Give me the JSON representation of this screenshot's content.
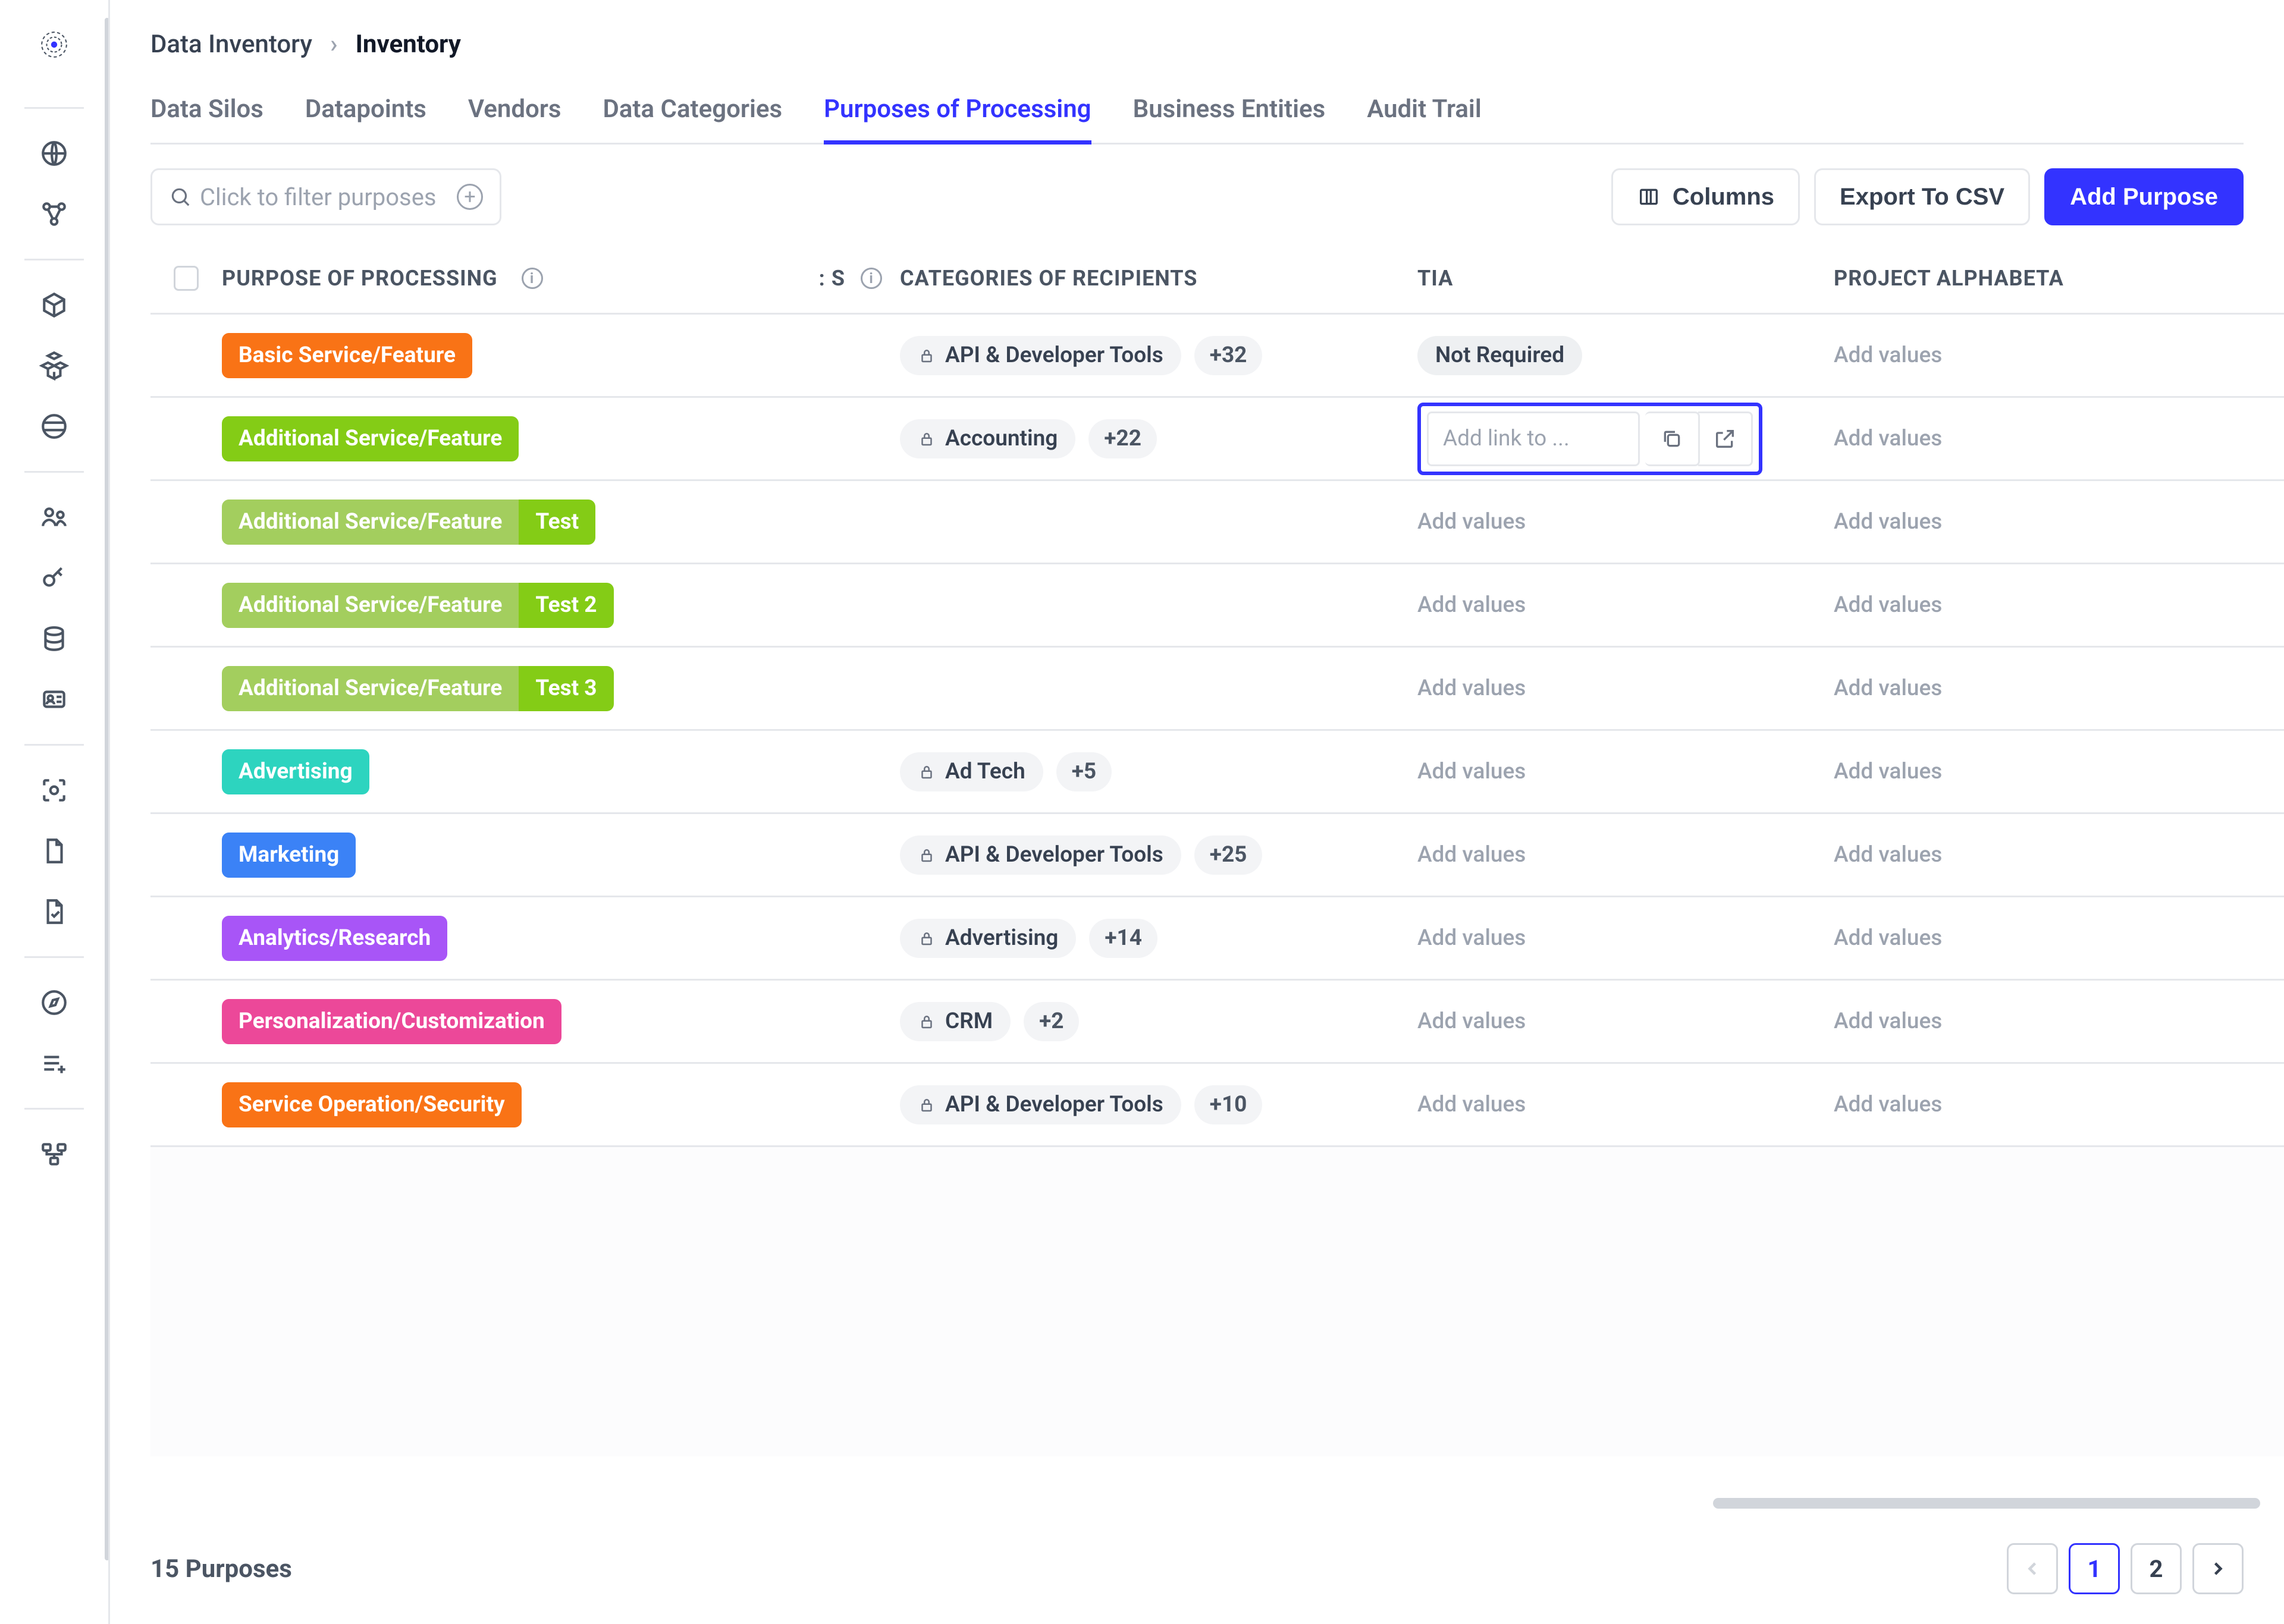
{
  "breadcrumbs": {
    "root": "Data Inventory",
    "current": "Inventory"
  },
  "tabs": [
    {
      "label": "Data Silos",
      "active": false
    },
    {
      "label": "Datapoints",
      "active": false
    },
    {
      "label": "Vendors",
      "active": false
    },
    {
      "label": "Data Categories",
      "active": false
    },
    {
      "label": "Purposes of Processing",
      "active": true
    },
    {
      "label": "Business Entities",
      "active": false
    },
    {
      "label": "Audit Trail",
      "active": false
    }
  ],
  "toolbar": {
    "filter_placeholder": "Click to filter purposes",
    "columns_label": "Columns",
    "export_label": "Export To CSV",
    "add_label": "Add Purpose"
  },
  "columns": {
    "purpose": "PURPOSE OF PROCESSING",
    "truncated_suffix": "S",
    "categories": "CATEGORIES OF RECIPIENTS",
    "tia": "TIA",
    "alphabeta": "PROJECT ALPHABETA"
  },
  "placeholders": {
    "add_values": "Add values",
    "add_link": "Add link to ..."
  },
  "tia_chip": {
    "not_required": "Not Required"
  },
  "rows": [
    {
      "tag": "Basic Service/Feature",
      "color": "#F97316",
      "sub": null,
      "cat": "API & Developer Tools",
      "count": "+32",
      "tia_mode": "not_required"
    },
    {
      "tag": "Additional Service/Feature",
      "color": "#84CC16",
      "sub": null,
      "cat": "Accounting",
      "count": "+22",
      "tia_mode": "editing"
    },
    {
      "tag": "Additional Service/Feature",
      "color": "#A3CE5E",
      "sub": "Test",
      "subcolor": "#84CC16",
      "cat": null,
      "count": null,
      "tia_mode": "empty"
    },
    {
      "tag": "Additional Service/Feature",
      "color": "#A3CE5E",
      "sub": "Test 2",
      "subcolor": "#84CC16",
      "cat": null,
      "count": null,
      "tia_mode": "empty"
    },
    {
      "tag": "Additional Service/Feature",
      "color": "#A3CE5E",
      "sub": "Test 3",
      "subcolor": "#84CC16",
      "cat": null,
      "count": null,
      "tia_mode": "empty"
    },
    {
      "tag": "Advertising",
      "color": "#2DD4BF",
      "sub": null,
      "cat": "Ad Tech",
      "count": "+5",
      "tia_mode": "empty"
    },
    {
      "tag": "Marketing",
      "color": "#3B82F6",
      "sub": null,
      "cat": "API & Developer Tools",
      "count": "+25",
      "tia_mode": "empty"
    },
    {
      "tag": "Analytics/Research",
      "color": "#A855F7",
      "sub": null,
      "cat": "Advertising",
      "count": "+14",
      "tia_mode": "empty"
    },
    {
      "tag": "Personalization/Customization",
      "color": "#EC4899",
      "sub": null,
      "cat": "CRM",
      "count": "+2",
      "tia_mode": "empty"
    },
    {
      "tag": "Service Operation/Security",
      "color": "#F97316",
      "sub": null,
      "cat": "API & Developer Tools",
      "count": "+10",
      "tia_mode": "empty"
    }
  ],
  "footer": {
    "count_text": "15 Purposes",
    "pages": [
      "1",
      "2"
    ],
    "active_page": "1"
  }
}
